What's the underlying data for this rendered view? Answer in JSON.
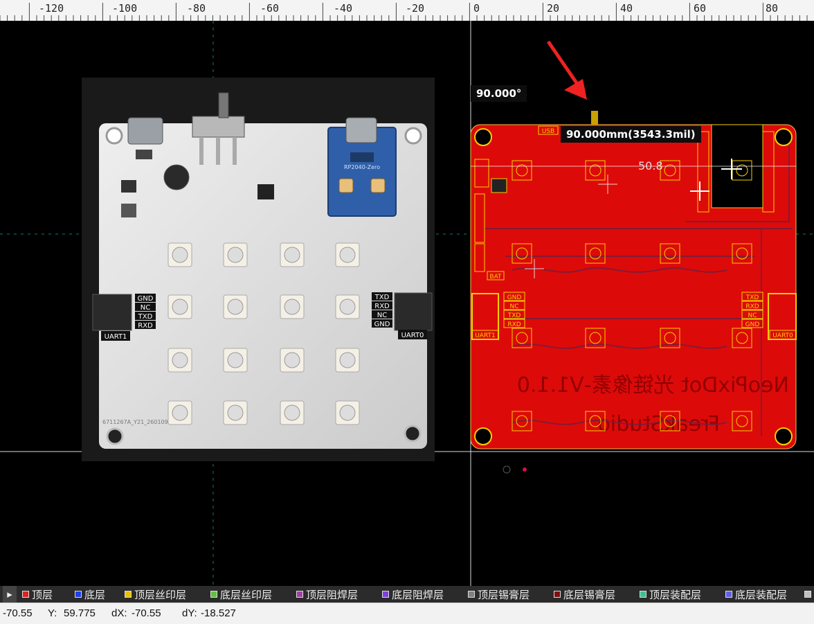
{
  "ruler": {
    "labels": [
      "-120",
      "-100",
      "-80",
      "-60",
      "-40",
      "-20",
      "0",
      "20",
      "40",
      "60",
      "80"
    ]
  },
  "photo": {
    "uart_left_pins": [
      "GND",
      "NC",
      "TXD",
      "RXD"
    ],
    "uart_left_name": "UART1",
    "uart_right_pins": [
      "TXD",
      "RXD",
      "NC",
      "GND"
    ],
    "uart_right_name": "UART0",
    "module_label": "RP2040-Zero",
    "footer_text": "6711267A_Y21_260109"
  },
  "pcb": {
    "uart_left_pins": [
      "GND",
      "NC",
      "TXD",
      "RXD"
    ],
    "uart_left_name": "UART1",
    "uart_right_pins": [
      "TXD",
      "RXD",
      "NC",
      "GND"
    ],
    "uart_right_name": "UART0",
    "title_text": "NeoPixDot 光链像素-V1.1.0",
    "studio_text": "FreakStudio",
    "usb_label": "USB",
    "bat_label": "BAT",
    "dim_value": "50.8"
  },
  "tooltips": {
    "angle": "90.000°",
    "measure": "90.000mm(3543.3mil)"
  },
  "layers": [
    {
      "label": "顶层",
      "color": "#e02020"
    },
    {
      "label": "底层",
      "color": "#2040e0"
    },
    {
      "label": "顶层丝印层",
      "color": "#e8c000"
    },
    {
      "label": "底层丝印层",
      "color": "#60c040"
    },
    {
      "label": "顶层阻焊层",
      "color": "#a040a0"
    },
    {
      "label": "底层阻焊层",
      "color": "#8040e0"
    },
    {
      "label": "顶层锡膏层",
      "color": "#808080"
    },
    {
      "label": "底层锡膏层",
      "color": "#801010"
    },
    {
      "label": "顶层装配层",
      "color": "#40c090"
    },
    {
      "label": "底层装配层",
      "color": "#6060e0"
    },
    {
      "label": "",
      "color": "#c0c0c0"
    }
  ],
  "status": {
    "x": "-70.55",
    "y_label": "Y:",
    "y": "59.775",
    "dx_label": "dX:",
    "dx": "-70.55",
    "dy_label": "dY:",
    "dy": "-18.527"
  }
}
